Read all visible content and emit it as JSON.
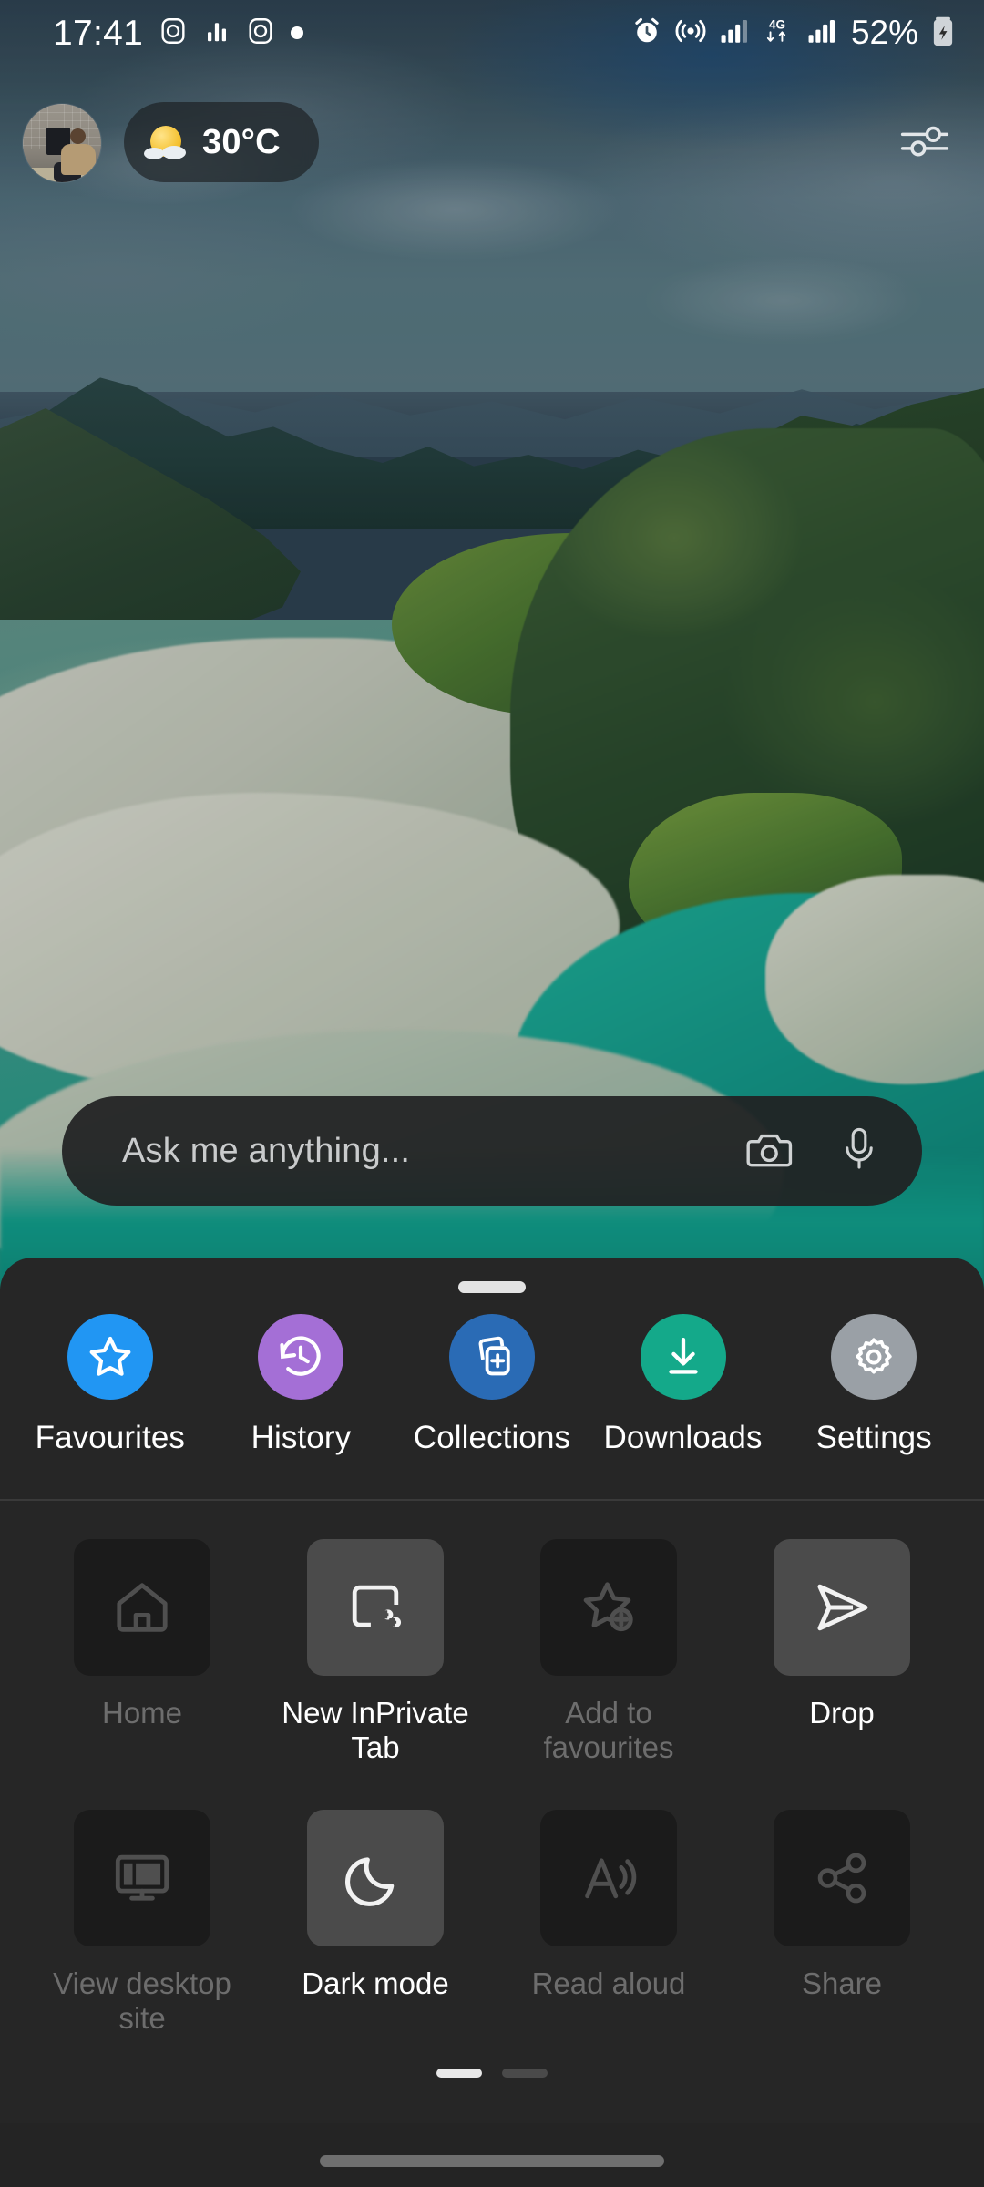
{
  "status_bar": {
    "time": "17:41",
    "left_icons": [
      "instagram-icon",
      "signal-bars-icon",
      "instagram-icon",
      "dot-indicator-icon"
    ],
    "right_icons": [
      "alarm-icon",
      "hotspot-icon",
      "signal-bars-icon",
      "4g-data-icon",
      "signal-bars-icon"
    ],
    "network_type": "4G",
    "battery_percent": "52%",
    "battery_state": "charging"
  },
  "home_hud": {
    "avatar_name": "profile-avatar",
    "weather": {
      "temperature": "30°C",
      "icon": "sun-behind-cloud-icon"
    },
    "tune_button_label": "tune-icon"
  },
  "search": {
    "placeholder": "Ask me anything...",
    "value": "",
    "camera_icon": "camera-icon",
    "mic_icon": "microphone-icon"
  },
  "sheet": {
    "handle": "drag-handle",
    "quick_actions": [
      {
        "label": "Favourites",
        "icon": "star-icon",
        "color": "#2196F3"
      },
      {
        "label": "History",
        "icon": "history-clock-icon",
        "color": "#A46FD6"
      },
      {
        "label": "Collections",
        "icon": "collections-icon",
        "color": "#2A6BB5"
      },
      {
        "label": "Downloads",
        "icon": "download-arrow-icon",
        "color": "#14A98A"
      },
      {
        "label": "Settings",
        "icon": "gear-icon",
        "color": "#9AA0A6"
      }
    ],
    "grid_items": [
      {
        "label": "Home",
        "icon": "home-icon",
        "enabled": false
      },
      {
        "label": "New InPrivate Tab",
        "icon": "inprivate-tab-icon",
        "enabled": true
      },
      {
        "label": "Add to favourites",
        "icon": "star-plus-icon",
        "enabled": false
      },
      {
        "label": "Drop",
        "icon": "send-plane-icon",
        "enabled": true
      },
      {
        "label": "View desktop site",
        "icon": "desktop-monitor-icon",
        "enabled": false
      },
      {
        "label": "Dark mode",
        "icon": "moon-icon",
        "enabled": true
      },
      {
        "label": "Read aloud",
        "icon": "read-aloud-icon",
        "enabled": false
      },
      {
        "label": "Share",
        "icon": "share-nodes-icon",
        "enabled": false
      }
    ],
    "page_indicator": {
      "total": 2,
      "current": 1
    }
  },
  "nav_bar": {
    "gesture_pill": "home-gesture-pill"
  },
  "colors": {
    "sheet_background": "#262626",
    "tile_enabled": "#4b4b4b",
    "tile_disabled": "#1b1b1b",
    "label_enabled": "#ffffff",
    "label_disabled": "#6d6d6d"
  }
}
